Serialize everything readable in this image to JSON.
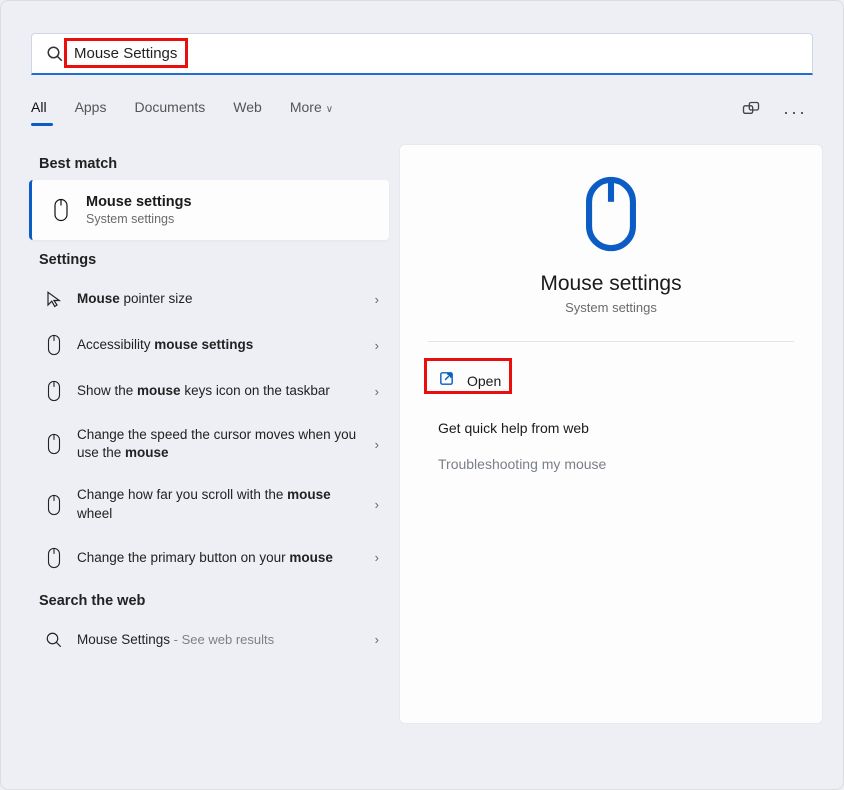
{
  "search": {
    "value": "Mouse Settings"
  },
  "tabs": {
    "all": "All",
    "apps": "Apps",
    "documents": "Documents",
    "web": "Web",
    "more": "More"
  },
  "sections": {
    "best_match": "Best match",
    "settings": "Settings",
    "search_web": "Search the web"
  },
  "best": {
    "title": "Mouse settings",
    "subtitle": "System settings"
  },
  "rows": {
    "r0": "<b>Mouse</b> pointer size",
    "r1": "Accessibility <b>mouse settings</b>",
    "r2": "Show the <b>mouse</b> keys icon on the taskbar",
    "r3": "Change the speed the cursor moves when you use the <b>mouse</b>",
    "r4": "Change how far you scroll with the <b>mouse</b> wheel",
    "r5": "Change the primary button on your <b>mouse</b>",
    "web": "Mouse Settings",
    "web_sub": " - See web results"
  },
  "pane": {
    "title": "Mouse settings",
    "subtitle": "System settings",
    "open": "Open",
    "help": "Get quick help from web",
    "trouble": "Troubleshooting my mouse"
  }
}
